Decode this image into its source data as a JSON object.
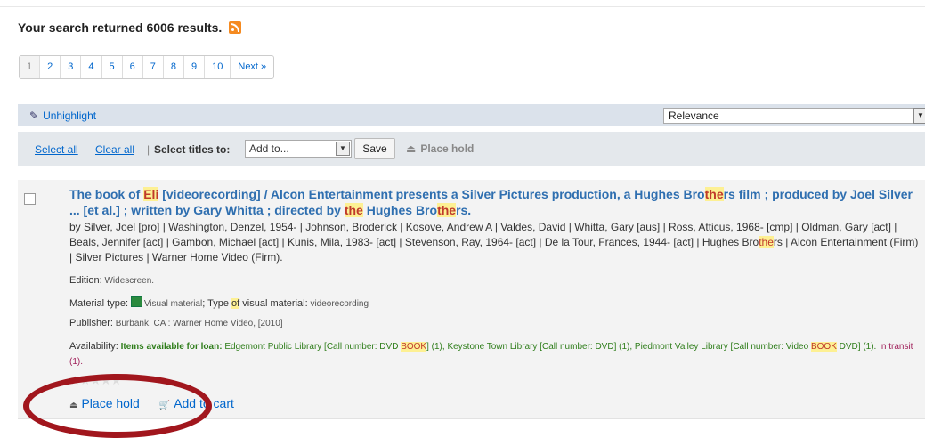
{
  "search": {
    "results_text": "Your search returned 6006 results."
  },
  "pagination": {
    "pages": [
      "1",
      "2",
      "3",
      "4",
      "5",
      "6",
      "7",
      "8",
      "9",
      "10"
    ],
    "next": "Next »"
  },
  "toolbar": {
    "unhighlight": "Unhighlight",
    "sort": "Relevance",
    "select_all": "Select all",
    "clear_all": "Clear all",
    "select_titles": "Select titles to:",
    "add_to": "Add to...",
    "save": "Save",
    "place_hold": "Place hold"
  },
  "result": {
    "title_parts": [
      "The book of ",
      "Eli",
      " [videorecording] / Alcon Entertainment presents a Silver Pictures production, a Hughes Bro",
      "the",
      "rs film ; produced by Joel Silver ... [et al.] ; written by Gary Whitta ; directed by ",
      "the",
      " Hughes Bro",
      "the",
      "rs."
    ],
    "authors_parts": [
      "by Silver, Joel [pro] | Washington, Denzel, 1954- | Johnson, Broderick | Kosove, Andrew A | Valdes, David | Whitta, Gary [aus] | Ross, Atticus, 1968- [cmp] | Oldman, Gary [act] | Beals, Jennifer [act] | Gambon, Michael [act] | Kunis, Mila, 1983- [act] | Stevenson, Ray, 1964- [act] | De la Tour, Frances, 1944- [act] | Hughes Bro",
      "the",
      "rs | Alcon Entertainment (Firm) | Silver Pictures | Warner Home Video (Firm)."
    ],
    "edition_label": "Edition:",
    "edition": "Widescreen.",
    "material_label": "Material type:",
    "material": "Visual material",
    "type_label_a": "; Type ",
    "type_of": "of",
    "type_label_b": " visual material:",
    "type_value": "videorecording",
    "publisher_label": "Publisher:",
    "publisher": "Burbank, CA : Warner Home Video, [2010]",
    "availability_label": "Availability:",
    "available_label": "Items available for loan:",
    "availability_text_a": "Edgemont Public Library [Call number: DVD ",
    "book1": "BOOK",
    "availability_text_b": "] (1), Keystone Town Library [Call number: DVD] (1), Piedmont Valley Library [Call number: Video ",
    "book2": "BOOK",
    "availability_text_c": " DVD] (1).",
    "in_transit": "In transit (1).",
    "rating_stars": "★★★★★",
    "place_hold": "Place hold",
    "add_to_cart": "Add to cart"
  },
  "colors": {
    "link": "#0066cc",
    "highlight_bg": "#fdf093",
    "annotation": "#a1161d"
  }
}
